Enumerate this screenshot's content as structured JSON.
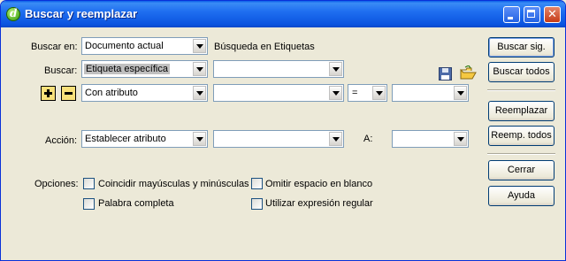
{
  "window": {
    "title": "Buscar y reemplazar"
  },
  "search_in": {
    "label": "Buscar en:",
    "value": "Documento actual",
    "info": "Búsqueda en Etiquetas"
  },
  "search": {
    "label": "Buscar:",
    "value": "Etiqueta específica",
    "tag_value": ""
  },
  "attribute_row": {
    "condition": "Con atributo",
    "attribute": "",
    "operator": "=",
    "value": ""
  },
  "action": {
    "label": "Acción:",
    "value": "Establecer atributo",
    "attribute": "",
    "to_label": "A:",
    "to_value": ""
  },
  "options": {
    "label": "Opciones:",
    "match_case": "Coincidir mayúsculas y minúsculas",
    "ignore_whitespace": "Omitir espacio en blanco",
    "whole_word": "Palabra completa",
    "regex": "Utilizar expresión regular"
  },
  "buttons": {
    "find_next": "Buscar sig.",
    "find_all": "Buscar todos",
    "replace": "Reemplazar",
    "replace_all": "Reemp. todos",
    "close": "Cerrar",
    "help": "Ayuda"
  },
  "icons": {
    "app": "dreamweaver-icon",
    "save": "save-icon",
    "open": "open-folder-icon",
    "add": "plus-icon",
    "remove": "minus-icon"
  }
}
